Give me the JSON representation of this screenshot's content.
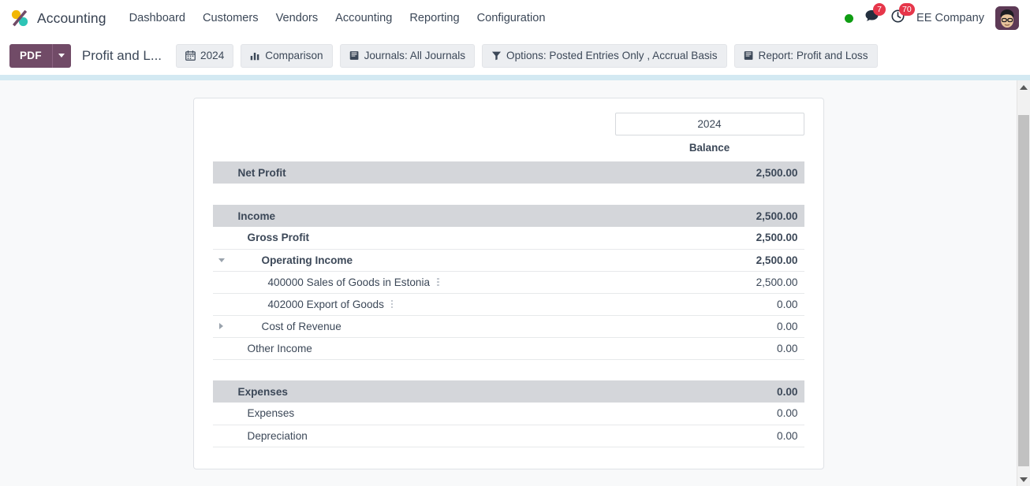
{
  "navbar": {
    "logo_icon": "odoo-logo-icon",
    "brand": "Accounting",
    "menu": [
      {
        "label": "Dashboard"
      },
      {
        "label": "Customers"
      },
      {
        "label": "Vendors"
      },
      {
        "label": "Accounting"
      },
      {
        "label": "Reporting"
      },
      {
        "label": "Configuration"
      }
    ],
    "status_indicator": "online-status-dot",
    "messages": {
      "icon": "chat-bubble-icon",
      "count": "7"
    },
    "activities": {
      "icon": "clock-icon",
      "count": "70"
    },
    "company": "EE Company",
    "avatar_icon": "user-avatar-icon"
  },
  "control_panel": {
    "pdf_label": "PDF",
    "pdf_caret_icon": "caret-down-icon",
    "report_title": "Profit and L...",
    "filters": [
      {
        "icon": "calendar-icon",
        "label": "2024"
      },
      {
        "icon": "bar-chart-icon",
        "label": "Comparison"
      },
      {
        "icon": "book-icon",
        "label": "Journals: All Journals"
      },
      {
        "icon": "funnel-icon",
        "label": "Options: Posted Entries Only , Accrual Basis"
      },
      {
        "icon": "book-icon",
        "label": "Report: Profit and Loss"
      }
    ]
  },
  "report": {
    "period_label": "2024",
    "column_header": "Balance",
    "rows": [
      {
        "label": "Net Profit",
        "value": "2,500.00",
        "indent": 0,
        "bold": true,
        "highlight": true,
        "muted": false,
        "caret": null,
        "dots": false,
        "border": false
      },
      {
        "spacer": true
      },
      {
        "label": "Income",
        "value": "2,500.00",
        "indent": 0,
        "bold": true,
        "highlight": true,
        "muted": false,
        "caret": null,
        "dots": false,
        "border": false
      },
      {
        "label": "Gross Profit",
        "value": "2,500.00",
        "indent": 1,
        "bold": true,
        "highlight": false,
        "muted": false,
        "caret": null,
        "dots": false,
        "border": true
      },
      {
        "label": "Operating Income",
        "value": "2,500.00",
        "indent": 2,
        "bold": true,
        "highlight": false,
        "muted": false,
        "caret": "down",
        "dots": false,
        "border": true
      },
      {
        "label": "400000 Sales of Goods in Estonia",
        "value": "2,500.00",
        "indent": 3,
        "bold": false,
        "highlight": false,
        "muted": false,
        "caret": null,
        "dots": true,
        "border": true
      },
      {
        "label": "402000 Export of Goods",
        "value": "0.00",
        "indent": 3,
        "bold": false,
        "highlight": false,
        "muted": true,
        "caret": null,
        "dots": true,
        "border": true
      },
      {
        "label": "Cost of Revenue",
        "value": "0.00",
        "indent": 2,
        "bold": false,
        "highlight": false,
        "muted": true,
        "caret": "right",
        "dots": false,
        "border": true
      },
      {
        "label": "Other Income",
        "value": "0.00",
        "indent": 1,
        "bold": false,
        "highlight": false,
        "muted": true,
        "caret": null,
        "dots": false,
        "border": true
      },
      {
        "spacer": true
      },
      {
        "label": "Expenses",
        "value": "0.00",
        "indent": 0,
        "bold": true,
        "highlight": true,
        "muted": true,
        "caret": null,
        "dots": false,
        "border": false
      },
      {
        "label": "Expenses",
        "value": "0.00",
        "indent": 1,
        "bold": false,
        "highlight": false,
        "muted": true,
        "caret": null,
        "dots": false,
        "border": true
      },
      {
        "label": "Depreciation",
        "value": "0.00",
        "indent": 1,
        "bold": false,
        "highlight": false,
        "muted": true,
        "caret": null,
        "dots": false,
        "border": true
      }
    ]
  },
  "scrollbar": {
    "up_icon": "scroll-up-arrow-icon",
    "down_icon": "scroll-down-arrow-icon"
  },
  "colors": {
    "brand_purple": "#714b67",
    "accent_band": "#d3e9f2",
    "row_highlight": "#d4d6da",
    "badge_red": "#e6364a",
    "status_green": "#0f9d13",
    "text": "#3c4858",
    "muted_text": "#b9bfc6"
  }
}
